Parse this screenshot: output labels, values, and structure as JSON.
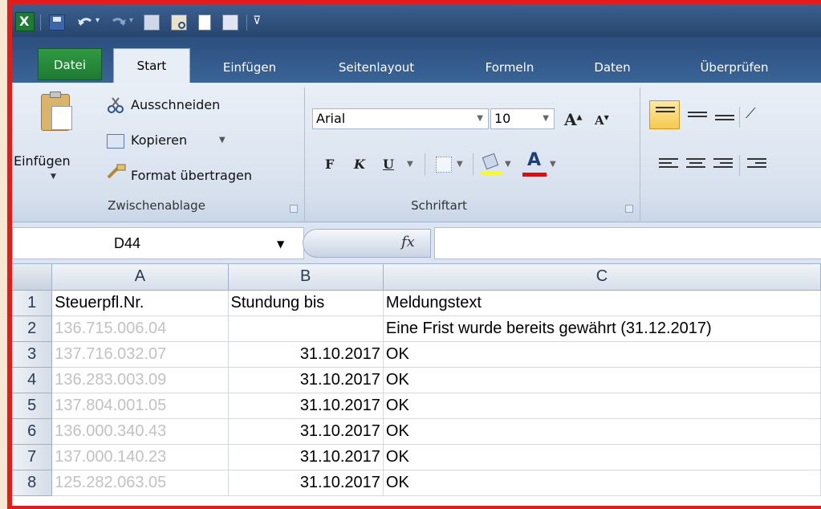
{
  "quick_access": {
    "icons": [
      "excel-logo-icon",
      "save-icon",
      "undo-icon",
      "redo-icon",
      "print-icon",
      "print-preview-icon",
      "new-document-icon",
      "form-icon",
      "customize-qat-icon"
    ]
  },
  "tabs": [
    {
      "label": "Datei"
    },
    {
      "label": "Start"
    },
    {
      "label": "Einfügen"
    },
    {
      "label": "Seitenlayout"
    },
    {
      "label": "Formeln"
    },
    {
      "label": "Daten"
    },
    {
      "label": "Überprüfen"
    }
  ],
  "ribbon": {
    "clipboard": {
      "paste_label": "Einfügen",
      "cut_label": "Ausschneiden",
      "copy_label": "Kopieren",
      "format_painter_label": "Format übertragen",
      "group_label": "Zwischenablage"
    },
    "font": {
      "font_name": "Arial",
      "font_size": "10",
      "bold_label": "F",
      "italic_label": "K",
      "underline_label": "U",
      "grow_label": "A",
      "shrink_label": "A",
      "font_color_label": "A",
      "group_label": "Schriftart",
      "colors": {
        "highlight": "#ffff00",
        "font": "#ff0000"
      }
    },
    "alignment": {
      "icons": [
        "align-top-icon",
        "align-middle-icon",
        "align-bottom-icon",
        "orientation-icon",
        "align-left-icon",
        "align-center-icon",
        "align-right-icon",
        "decrease-indent-icon"
      ]
    }
  },
  "formula_bar": {
    "name_box": "D44",
    "fx_label": "fx",
    "value": ""
  },
  "sheet": {
    "columns": [
      "A",
      "B",
      "C"
    ],
    "header_row": {
      "row": "1",
      "cells": [
        "Steuerpfl.Nr.",
        "Stundung bis",
        "Meldungstext"
      ]
    },
    "rows": [
      {
        "row": "2",
        "a": "136.715.006.04",
        "b": "",
        "c": "Eine Frist wurde bereits gewährt (31.12.2017)"
      },
      {
        "row": "3",
        "a": "137.716.032.07",
        "b": "31.10.2017",
        "c": "OK"
      },
      {
        "row": "4",
        "a": "136.283.003.09",
        "b": "31.10.2017",
        "c": "OK"
      },
      {
        "row": "5",
        "a": "137.804.001.05",
        "b": "31.10.2017",
        "c": "OK"
      },
      {
        "row": "6",
        "a": "136.000.340.43",
        "b": "31.10.2017",
        "c": "OK"
      },
      {
        "row": "7",
        "a": "137.000.140.23",
        "b": "31.10.2017",
        "c": "OK"
      },
      {
        "row": "8",
        "a": "125.282.063.05",
        "b": "31.10.2017",
        "c": "OK"
      }
    ]
  }
}
